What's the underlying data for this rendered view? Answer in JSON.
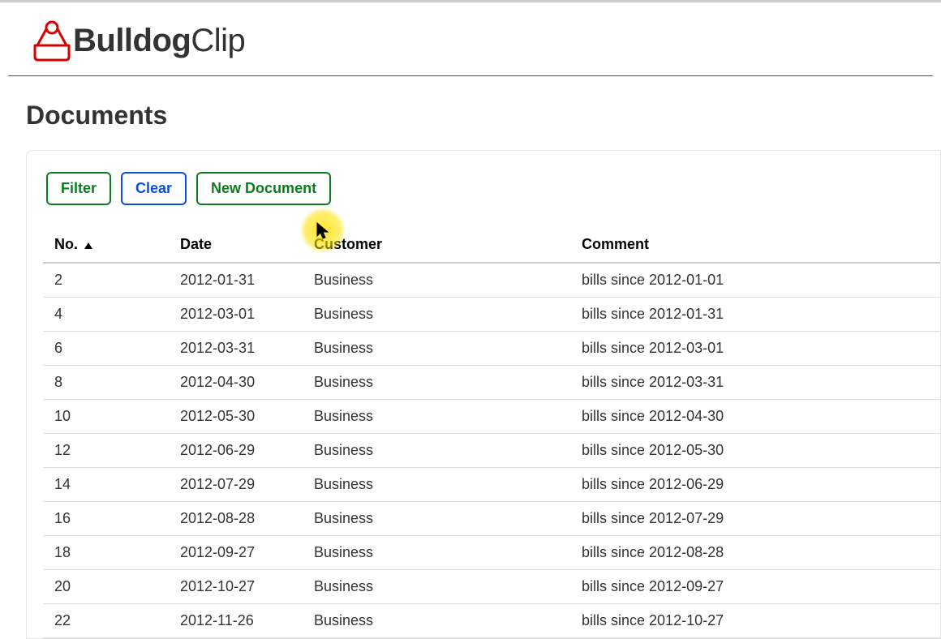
{
  "logo": {
    "bold": "Bulldog",
    "light": "Clip"
  },
  "page_title": "Documents",
  "buttons": {
    "filter": "Filter",
    "clear": "Clear",
    "new_document": "New Document"
  },
  "table": {
    "headers": {
      "no": "No.",
      "date": "Date",
      "customer": "Customer",
      "comment": "Comment"
    },
    "rows": [
      {
        "no": "2",
        "date": "2012-01-31",
        "customer": "Business",
        "comment": "bills since 2012-01-01"
      },
      {
        "no": "4",
        "date": "2012-03-01",
        "customer": "Business",
        "comment": "bills since 2012-01-31"
      },
      {
        "no": "6",
        "date": "2012-03-31",
        "customer": "Business",
        "comment": "bills since 2012-03-01"
      },
      {
        "no": "8",
        "date": "2012-04-30",
        "customer": "Business",
        "comment": "bills since 2012-03-31"
      },
      {
        "no": "10",
        "date": "2012-05-30",
        "customer": "Business",
        "comment": "bills since 2012-04-30"
      },
      {
        "no": "12",
        "date": "2012-06-29",
        "customer": "Business",
        "comment": "bills since 2012-05-30"
      },
      {
        "no": "14",
        "date": "2012-07-29",
        "customer": "Business",
        "comment": "bills since 2012-06-29"
      },
      {
        "no": "16",
        "date": "2012-08-28",
        "customer": "Business",
        "comment": "bills since 2012-07-29"
      },
      {
        "no": "18",
        "date": "2012-09-27",
        "customer": "Business",
        "comment": "bills since 2012-08-28"
      },
      {
        "no": "20",
        "date": "2012-10-27",
        "customer": "Business",
        "comment": "bills since 2012-09-27"
      },
      {
        "no": "22",
        "date": "2012-11-26",
        "customer": "Business",
        "comment": "bills since 2012-10-27"
      }
    ]
  }
}
